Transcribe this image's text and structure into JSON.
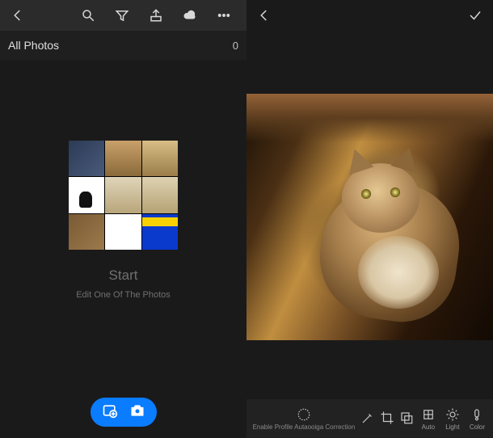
{
  "left": {
    "topbar_icons": {
      "back": "back-icon",
      "search": "search-icon",
      "filter": "filter-icon",
      "share": "share-icon",
      "cloud": "cloud-icon",
      "more": "more-icon"
    },
    "subheader": {
      "title": "All Photos",
      "count": "0"
    },
    "start": {
      "title": "Start",
      "subtitle": "Edit One Of The Photos"
    },
    "pill": {
      "add_photo": "add-photo-icon",
      "camera": "camera-icon"
    }
  },
  "right": {
    "topbar": {
      "back": "back-icon",
      "confirm": "checkmark-icon"
    },
    "image": {
      "description": "cat lying on warm ground in sunlight"
    },
    "toolbar": {
      "profile_label": "Enable Profile Autaooiga Correction",
      "crop_label": "",
      "presets_label": "",
      "auto_label": "Auto",
      "light_label": "Light",
      "color_label": "Color"
    }
  }
}
